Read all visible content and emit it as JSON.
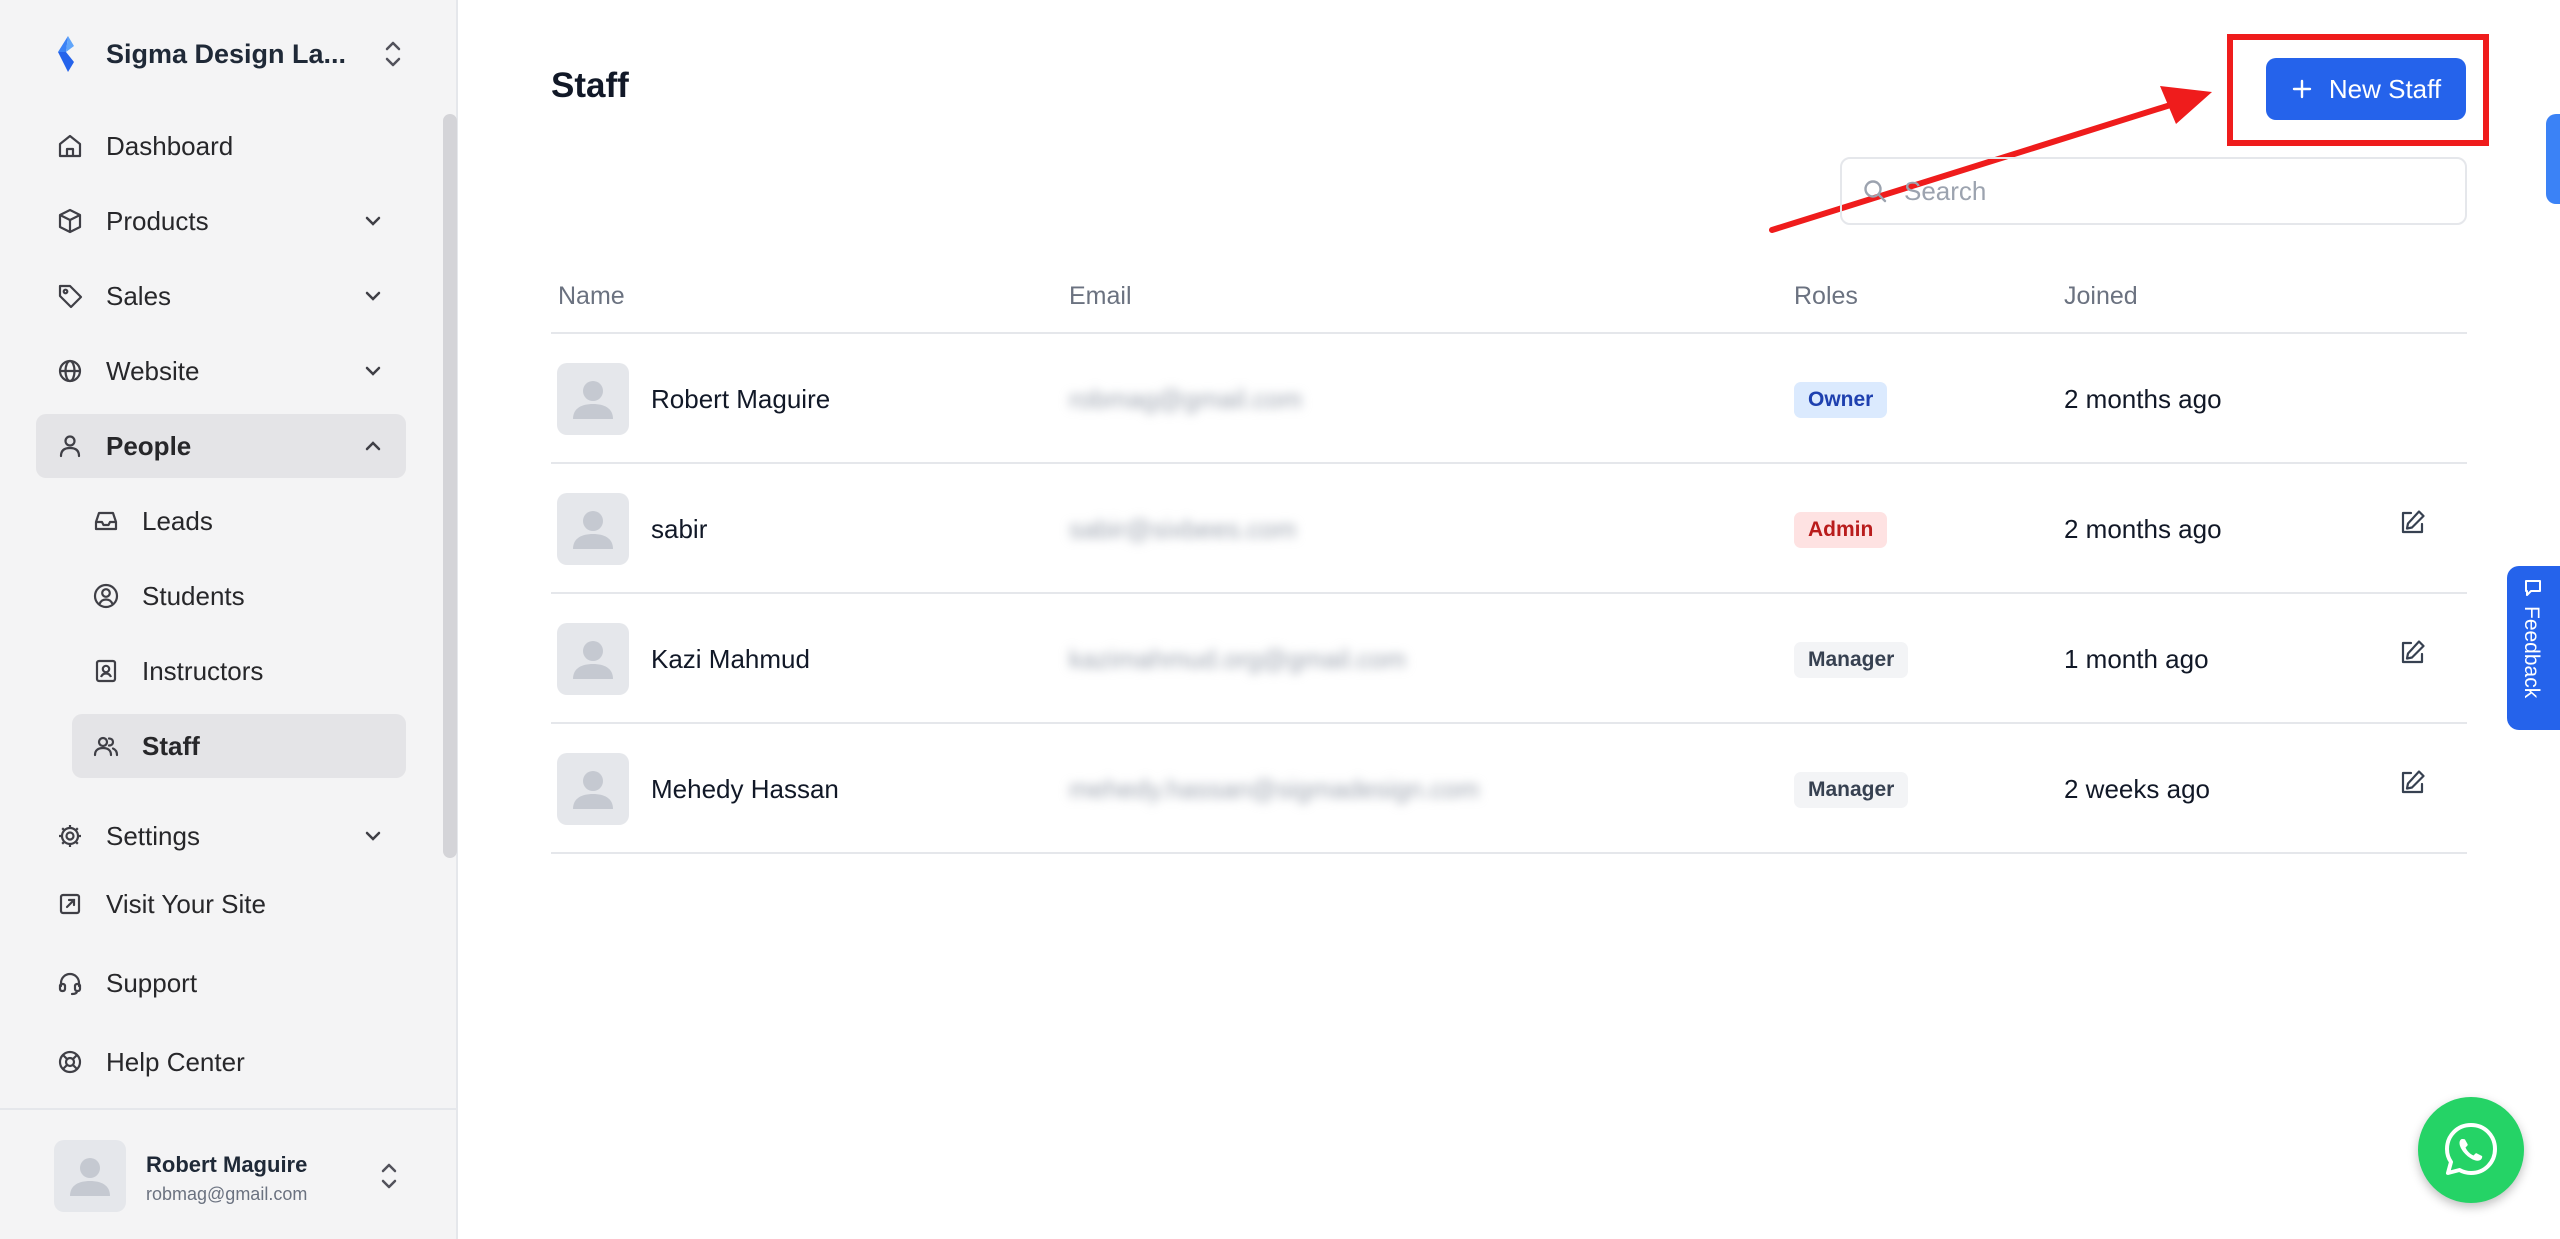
{
  "sidebar": {
    "brand": "Sigma Design La...",
    "nav": [
      {
        "label": "Dashboard",
        "icon": "home-icon"
      },
      {
        "label": "Products",
        "icon": "box-icon"
      },
      {
        "label": "Sales",
        "icon": "tag-icon"
      },
      {
        "label": "Website",
        "icon": "globe-icon"
      },
      {
        "label": "People",
        "icon": "user-icon"
      },
      {
        "label": "Leads",
        "icon": "inbox-icon"
      },
      {
        "label": "Students",
        "icon": "user-circle-icon"
      },
      {
        "label": "Instructors",
        "icon": "id-badge-icon"
      },
      {
        "label": "Staff",
        "icon": "users-icon"
      },
      {
        "label": "Settings",
        "icon": "gear-icon"
      },
      {
        "label": "Visit Your Site",
        "icon": "external-link-icon"
      },
      {
        "label": "Support",
        "icon": "headset-icon"
      },
      {
        "label": "Help Center",
        "icon": "lifebuoy-icon"
      }
    ],
    "user": {
      "name": "Robert Maguire",
      "email": "robmag@gmail.com"
    }
  },
  "main": {
    "title": "Staff",
    "new_button_label": "New Staff",
    "search_placeholder": "Search",
    "columns": [
      "Name",
      "Email",
      "Roles",
      "Joined"
    ],
    "rows": [
      {
        "name": "Robert Maguire",
        "email": "robmag@gmail.com",
        "role": "Owner",
        "joined": "2 months ago"
      },
      {
        "name": "sabir",
        "email": "sabir@sixbees.com",
        "role": "Admin",
        "joined": "2 months ago"
      },
      {
        "name": "Kazi Mahmud",
        "email": "kazimahmud.org@gmail.com",
        "role": "Manager",
        "joined": "1 month ago"
      },
      {
        "name": "Mehedy Hassan",
        "email": "mehedy.hassan@sigmadesign.com",
        "role": "Manager",
        "joined": "2 weeks ago"
      }
    ]
  },
  "widgets": {
    "feedback_label": "Feedback"
  },
  "colors": {
    "primary": "#2563eb",
    "annotation": "#ef1c1c",
    "whatsapp": "#25d366"
  }
}
